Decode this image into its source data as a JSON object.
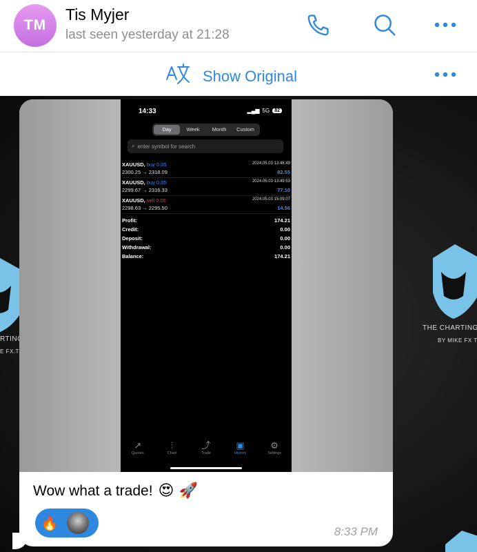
{
  "header": {
    "avatar_initials": "TM",
    "contact_name": "Tis Myjer",
    "last_seen": "last seen yesterday at 21:28",
    "icons": [
      "phone-icon",
      "search-icon",
      "more-icon"
    ],
    "accent_color": "#2f88e0"
  },
  "translate_bar": {
    "label": "Show Original",
    "icon": "translate-icon"
  },
  "watermark": {
    "line1": "THE CHARTING",
    "line2": "BY MIKE FX TRA",
    "left_line1": "RTING",
    "left_line2": "E FX.TRA"
  },
  "screenshot": {
    "time": "14:33",
    "network": "5G",
    "battery": "82",
    "segments": [
      "Day",
      "Week",
      "Month",
      "Custom"
    ],
    "active_segment": "Day",
    "search_placeholder": "enter symbol for search",
    "trades": [
      {
        "symbol": "XAUUSD,",
        "side": "buy 0.05",
        "side_color": "#3a8bf5",
        "date": "2024.05.03 13:48:49",
        "prices": "2300.25 → 2318.09",
        "pnl": "82.55"
      },
      {
        "symbol": "XAUUSD,",
        "side": "buy 0.05",
        "side_color": "#3a8bf5",
        "date": "2024.05.03 13:49:53",
        "prices": "2299.67 → 2316.33",
        "pnl": "77.10"
      },
      {
        "symbol": "XAUUSD,",
        "side": "sell 0.05",
        "side_color": "#e83a3a",
        "date": "2024.05.03 15:09:07",
        "prices": "2298.63 → 2295.50",
        "pnl": "14.56"
      }
    ],
    "summary": [
      {
        "label": "Profit:",
        "value": "174.21"
      },
      {
        "label": "Credit:",
        "value": "0.00"
      },
      {
        "label": "Deposit:",
        "value": "0.00"
      },
      {
        "label": "Withdrawal:",
        "value": "0.00"
      },
      {
        "label": "Balance:",
        "value": "174.21"
      }
    ],
    "tabs": [
      {
        "label": "Quotes",
        "icon": "↗"
      },
      {
        "label": "Chart",
        "icon": "⫶"
      },
      {
        "label": "Trade",
        "icon": "⤴"
      },
      {
        "label": "History",
        "icon": "▣"
      },
      {
        "label": "Settings",
        "icon": "⚙"
      }
    ],
    "active_tab": "History"
  },
  "message": {
    "text": "Wow what a trade!",
    "emojis": "😍 🚀",
    "reactions": [
      {
        "emoji": "🔥"
      }
    ],
    "time": "8:33 PM"
  }
}
